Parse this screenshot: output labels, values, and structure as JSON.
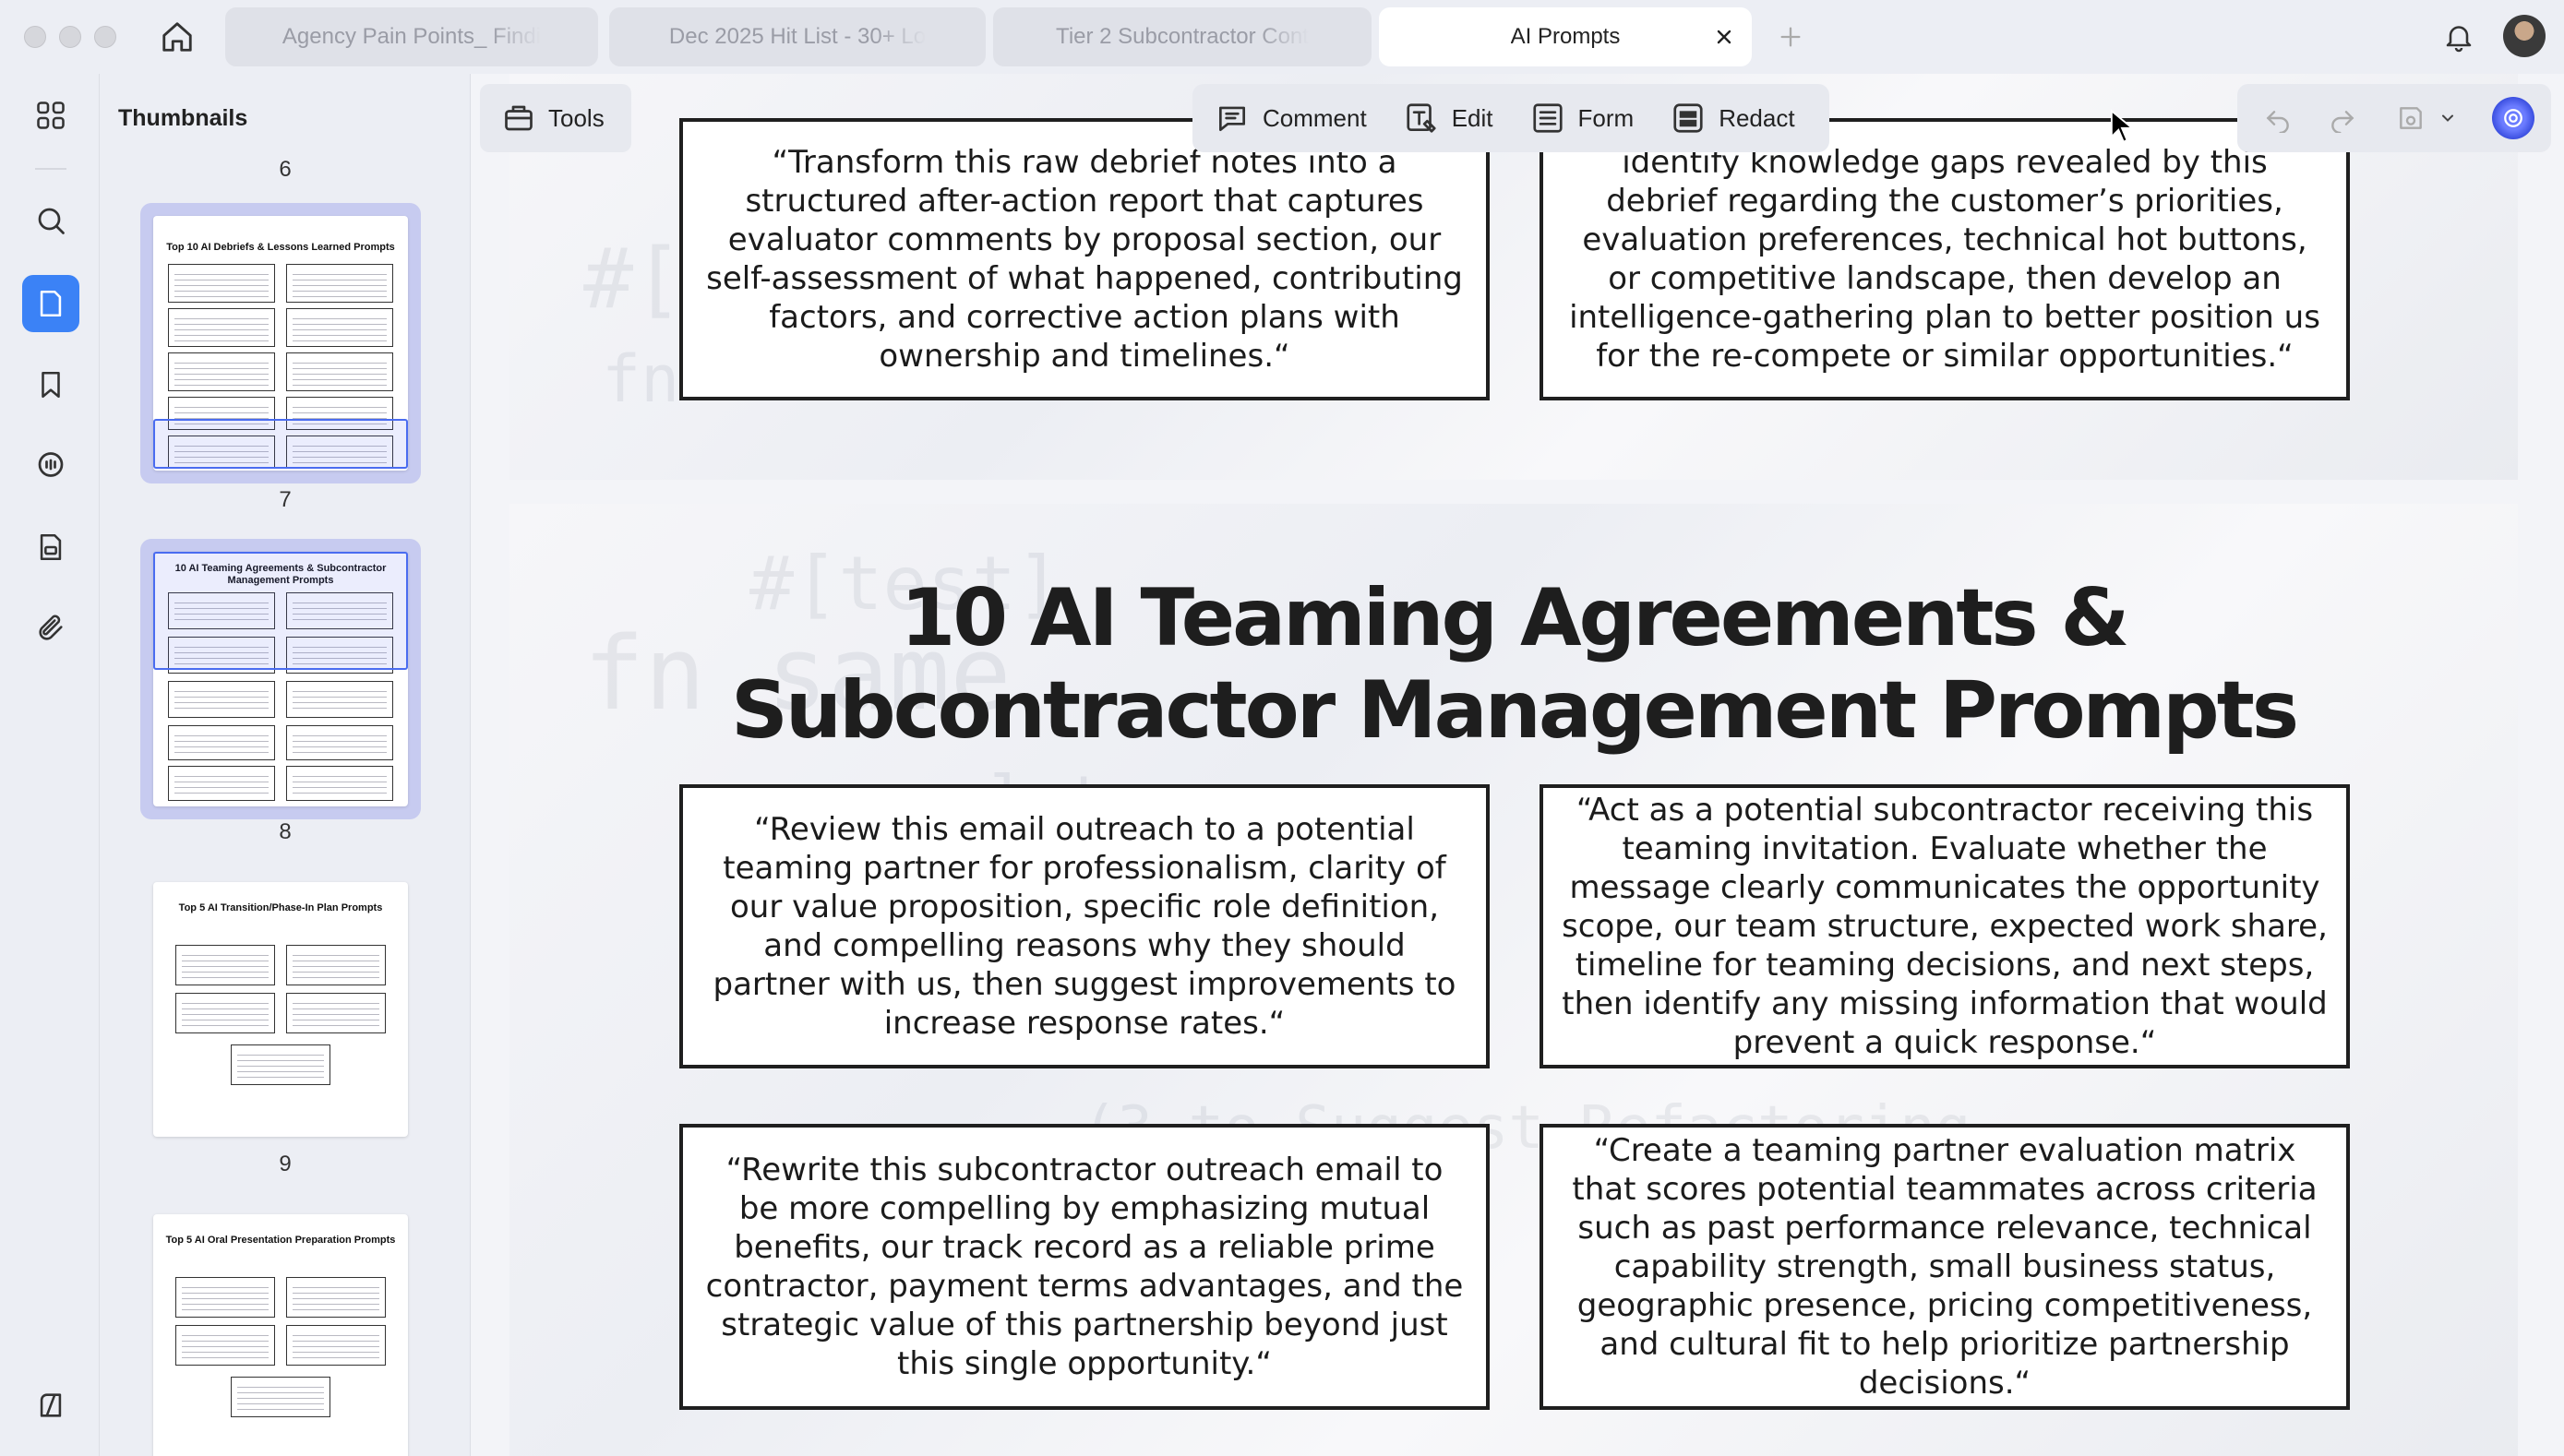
{
  "window": {
    "controls": [
      "close",
      "minimize",
      "zoom"
    ]
  },
  "tabs": [
    {
      "label": "Agency Pain Points_ Findi",
      "active": false
    },
    {
      "label": "Dec 2025 Hit List - 30+ Lo",
      "active": false
    },
    {
      "label": "Tier 2 Subcontractor Cont",
      "active": false
    },
    {
      "label": "AI Prompts",
      "active": true
    }
  ],
  "toolbar": {
    "tools_label": "Tools",
    "comment_label": "Comment",
    "edit_label": "Edit",
    "form_label": "Form",
    "redact_label": "Redact"
  },
  "sidebar": {
    "title": "Thumbnails",
    "pages": [
      {
        "number": "6"
      },
      {
        "number": "7",
        "title": "Top 10 AI Debriefs & Lessons Learned Prompts"
      },
      {
        "number": "8",
        "title": "10 AI Teaming Agreements & Subcontractor Management Prompts"
      },
      {
        "number": "9",
        "title": "Top 5 AI Transition/Phase-In Plan Prompts"
      },
      {
        "number": "",
        "title": "Top 5 AI Oral Presentation Preparation Prompts"
      }
    ]
  },
  "document": {
    "top_prompts": [
      "“Transform this raw debrief notes into a structured after-action report that captures evaluator comments by proposal section, our self-assessment of what happened, contributing factors, and corrective action plans with ownership and timelines.“",
      "identify knowledge gaps revealed by this debrief regarding the customer’s priorities, evaluation preferences, technical hot buttons, or competitive landscape, then develop an intelligence-gathering plan to better position us for the re-compete or similar opportunities.“"
    ],
    "section_title_line1": "10 AI Teaming Agreements &",
    "section_title_line2": "Subcontractor Management Prompts",
    "prompts": [
      "“Review this email outreach to a potential teaming partner for professionalism, clarity of our value proposition, specific role definition, and compelling reasons why they should partner with us, then suggest improvements to increase response rates.“",
      "“Act as a potential subcontractor receiving this teaming invitation. Evaluate whether the message clearly communicates the opportunity scope, our team structure, expected work share, timeline for teaming decisions, and next steps, then identify any missing information that would prevent a quick response.“",
      "“Rewrite this subcontractor outreach email to be more compelling by emphasizing mutual benefits, our track record as a reliable prime contractor, payment terms advantages, and the strategic value of this partnership beyond just this single opportunity.“",
      "“Create a teaming partner evaluation matrix that scores potential teammates across criteria such as past performance relevance, technical capability strength, small business status, geographic presence, pricing competitiveness, and cultural fit to help prioritize partnership decisions.“"
    ],
    "background_code": [
      "#[test]",
      "fn same",
      "let cases",
      "(3 to Suggest Refactoring",
      "#[",
      "fn"
    ]
  },
  "colors": {
    "accent": "#3b82f6",
    "thumb_selected": "#c7cbf0",
    "card_border": "#1f1f1f"
  }
}
